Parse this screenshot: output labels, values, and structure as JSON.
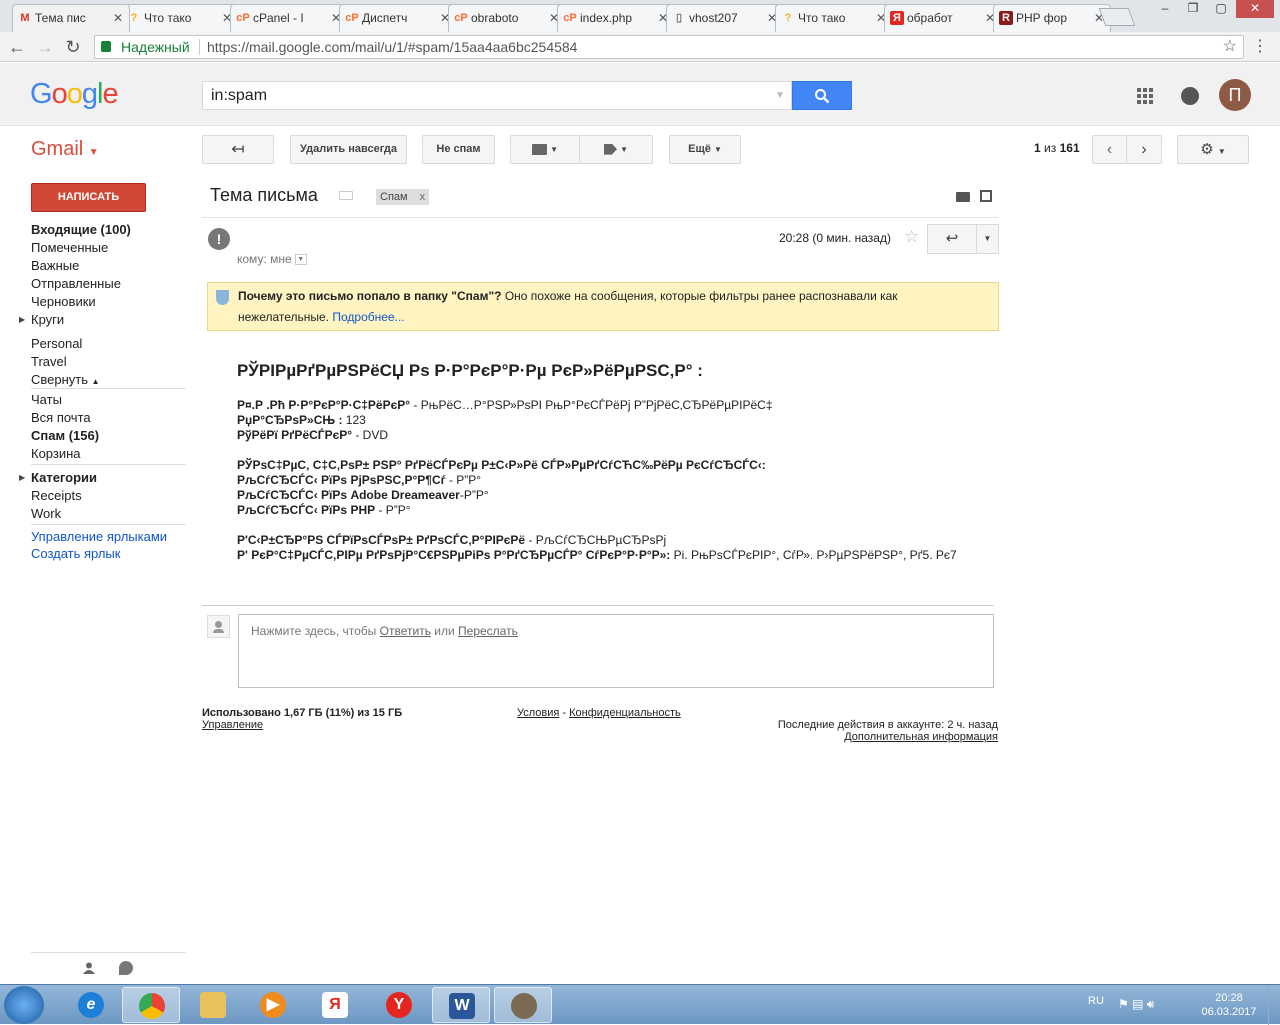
{
  "browser": {
    "tabs": [
      {
        "label": "Тема пис",
        "favicon": "gmail",
        "active": true
      },
      {
        "label": "Что тако",
        "favicon": "yandex-question"
      },
      {
        "label": "cPanel - I",
        "favicon": "cpanel"
      },
      {
        "label": "Диспетч",
        "favicon": "cpanel"
      },
      {
        "label": "obraboto",
        "favicon": "cpanel"
      },
      {
        "label": "index.php",
        "favicon": "cpanel"
      },
      {
        "label": "vhost207",
        "favicon": "document"
      },
      {
        "label": "Что тако",
        "favicon": "yandex-question"
      },
      {
        "label": "обработ",
        "favicon": "yandex"
      },
      {
        "label": "PHP фор",
        "favicon": "r-logo"
      }
    ],
    "secure_label": "Надежный",
    "url": "https://mail.google.com/mail/u/1/#spam/15aa4aa6bc254584"
  },
  "header": {
    "logo": "Google",
    "search_value": "in:spam",
    "avatar_letter": "П"
  },
  "gmail": {
    "product_label": "Gmail",
    "compose": "НАПИСАТЬ",
    "actions": {
      "delete_forever": "Удалить навсегда",
      "not_spam": "Не спам",
      "more": "Ещё"
    },
    "pager": {
      "current": "1",
      "sep": "из",
      "total": "161"
    }
  },
  "sidebar": {
    "items": [
      {
        "label": "Входящие (100)",
        "bold": true
      },
      {
        "label": "Помеченные"
      },
      {
        "label": "Важные"
      },
      {
        "label": "Отправленные"
      },
      {
        "label": "Черновики"
      },
      {
        "label": "Круги"
      },
      {
        "label": "Personal"
      },
      {
        "label": "Travel"
      },
      {
        "label": "Свернуть"
      },
      {
        "label": "Чаты"
      },
      {
        "label": "Вся почта"
      },
      {
        "label": "Спам (156)",
        "bold": true
      },
      {
        "label": "Корзина"
      },
      {
        "label": "Категории",
        "bold": true
      },
      {
        "label": "Receipts"
      },
      {
        "label": "Work"
      },
      {
        "label": "Управление ярлыками"
      },
      {
        "label": "Создать ярлык"
      }
    ]
  },
  "message": {
    "subject": "Тема письма",
    "label_chip": "Спам",
    "label_chip_close": "x",
    "time": "20:28 (0 мин. назад)",
    "to": "кому: мне",
    "warning_bold": "Почему это письмо попало в папку \"Спам\"?",
    "warning_text": " Оно похоже на сообщения, которые фильтры ранее распознавали как нежелательные. ",
    "warning_link": "Подробнее...",
    "body": {
      "heading": "РЎРІРµРґРµРЅРёСЏ Рѕ Р·Р°РєР°Р·Рµ РєР»РёРµРЅС‚Р° :",
      "line1_label": "Р¤.Р .Рћ Р·Р°РєР°Р·С‡РёРєР°",
      "line1_value": " - РњРёС…Р°РЅР»РѕРІ РњР°РєСЃРёРј Р”РјРёС‚СЂРёРµРІРёС‡",
      "line2_label": "РџР°СЂРѕР»СЊ :",
      "line2_value": " 123",
      "line3_label": "РўРёРї РґРёСЃРєР°",
      "line3_value": " - DVD",
      "line4_label": "РЎРѕС‡РµС‚ С‡С‚РѕР± РЅР° РґРёСЃРєРµ Р±С‹Р»Рё СЃР»РµРґСѓСЋС‰РёРµ РєСѓСЂСЃС‹:",
      "line5_label": "РљСѓСЂСЃС‹ РїРѕ РјРѕРЅС‚Р°Р¶Сѓ",
      "line5_value": " - Р”Р°",
      "line6_label": "РљСѓСЂСЃС‹ РїРѕ Adobe Dreameaver",
      "line6_value": "-Р”Р°",
      "line7_label": "РљСѓСЂСЃС‹ РїРѕ PHP",
      "line7_value": " - Р”Р°",
      "line8_label": "Р'С‹Р±СЂР°РЅ СЃРїРѕСЃРѕР± РґРѕСЃС‚Р°РІРєРё",
      "line8_value": " - РљСѓСЂСЊРµСЂРѕРј",
      "line9_label": "Р' РєР°С‡РµСЃС‚РІРµ РґРѕРјР°С€РЅРµРіРѕ Р°РґСЂРµСЃР° СѓРєР°Р·Р°Р»:",
      "line9_value": " Рі. РњРѕСЃРєРІР°, СѓР». Р›РµРЅРёРЅР°, Рґ5. Рє7"
    },
    "reply_prompt": "Нажмите здесь, чтобы ",
    "reply_link": "Ответить",
    "reply_or": " или ",
    "forward_link": "Переслать"
  },
  "footer": {
    "usage": "Использовано 1,67 ГБ (11%) из 15 ГБ",
    "manage": "Управление",
    "terms": "Условия",
    "dash": " - ",
    "privacy": "Конфиденциальность",
    "last_activity": "Последние действия в аккаунте: 2 ч. назад",
    "details": "Дополнительная информация"
  },
  "taskbar": {
    "lang": "RU",
    "time": "20:28",
    "date": "06.03.2017",
    "apps": [
      "ie",
      "chrome",
      "explorer",
      "media-player",
      "yandex-browser",
      "yandex",
      "word",
      "gimp"
    ]
  }
}
